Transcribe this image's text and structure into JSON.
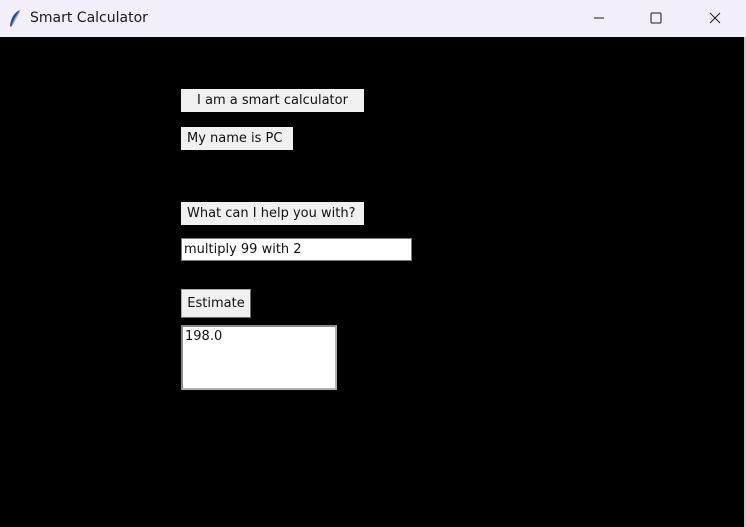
{
  "window": {
    "title": "Smart Calculator",
    "app_icon": "feather-icon",
    "controls": {
      "minimize_icon": "minimize-icon",
      "maximize_icon": "maximize-icon",
      "close_icon": "close-icon"
    },
    "background_color": "#000000",
    "titlebar_color": "#f3eef7"
  },
  "labels": {
    "intro": "I am a smart calculator",
    "name": "My name is PC",
    "prompt": "What can I help you with?"
  },
  "query": {
    "value": "multiply 99 with 2"
  },
  "estimate_button": {
    "label": "Estimate"
  },
  "result": {
    "value": "198.0"
  }
}
